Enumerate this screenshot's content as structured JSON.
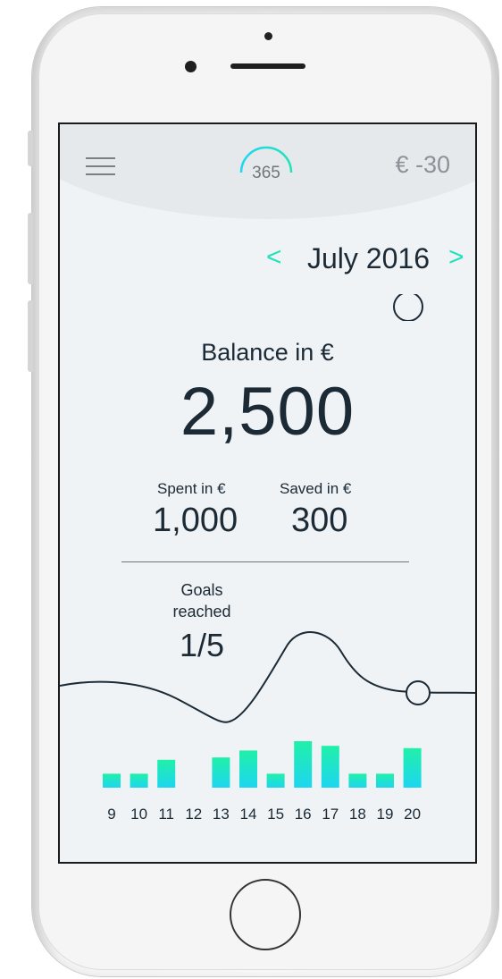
{
  "header": {
    "logo_text": "365",
    "balance_delta": "€ -30"
  },
  "month_nav": {
    "prev": "<",
    "label": "July 2016",
    "next": ">"
  },
  "balance": {
    "label": "Balance in €",
    "value": "2,500"
  },
  "stats": {
    "spent_label": "Spent in €",
    "spent_value": "1,000",
    "saved_label": "Saved in €",
    "saved_value": "300"
  },
  "goals": {
    "label": "Goals reached",
    "value": "1/5"
  },
  "colors": {
    "accent": "#20e3b9",
    "accent_cyan": "#1ed6f0",
    "text_dark": "#1b2a35"
  },
  "chart_data": {
    "type": "bar",
    "categories": [
      "9",
      "10",
      "11",
      "12",
      "13",
      "14",
      "15",
      "16",
      "17",
      "18",
      "19",
      "20"
    ],
    "values": [
      3,
      3,
      6,
      0,
      6.5,
      8,
      3,
      10,
      9,
      3,
      3,
      8.5
    ]
  }
}
